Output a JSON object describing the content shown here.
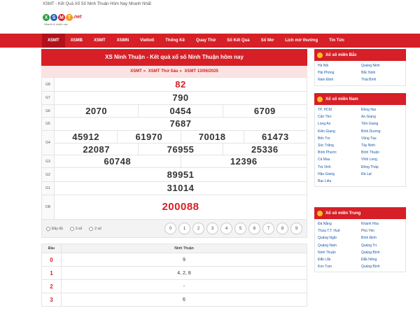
{
  "page_title": "XSMT - Kết Quả Xổ Số Ninh Thuận Hôm Nay Nhanh Nhất",
  "logo": {
    "letters": [
      "X",
      "S",
      "M",
      "T"
    ],
    "suffix": ".net",
    "slogan": "Nhanh & chính xác"
  },
  "nav": [
    "XSMT",
    "XSMB",
    "XSMT",
    "XSMN",
    "Vietlott",
    "Thống Kê",
    "Quay Thử",
    "Sổ Kết Quả",
    "Sổ Mơ",
    "Lịch mở thưởng",
    "Tin Tức"
  ],
  "main": {
    "title": "XS Ninh Thuận - Kết quả xổ số Ninh Thuận hôm nay",
    "breadcrumb": [
      "XSMT",
      "XSMT Thứ Sáu",
      "XSMT 13/06/2025"
    ],
    "prizes": [
      {
        "label": "G8",
        "rows": [
          [
            "82"
          ]
        ],
        "highlight": true
      },
      {
        "label": "G7",
        "rows": [
          [
            "790"
          ]
        ]
      },
      {
        "label": "G6",
        "rows": [
          [
            "2070",
            "0454",
            "6709"
          ]
        ]
      },
      {
        "label": "G5",
        "rows": [
          [
            "7687"
          ]
        ]
      },
      {
        "label": "G4",
        "rows": [
          [
            "45912",
            "61970",
            "70018",
            "61473"
          ],
          [
            "22087",
            "76955",
            "25336"
          ]
        ]
      },
      {
        "label": "G3",
        "rows": [
          [
            "60748",
            "12396"
          ]
        ]
      },
      {
        "label": "G2",
        "rows": [
          [
            "89951"
          ]
        ]
      },
      {
        "label": "G1",
        "rows": [
          [
            "31014"
          ]
        ]
      },
      {
        "label": "DB",
        "rows": [
          [
            "200088"
          ]
        ],
        "highlight": true
      }
    ],
    "filter": {
      "options": [
        "Đầy đủ",
        "3 số",
        "2 số"
      ],
      "digits": [
        "0",
        "1",
        "2",
        "3",
        "4",
        "5",
        "6",
        "7",
        "8",
        "9"
      ]
    },
    "loto": {
      "headers": [
        "Đầu",
        "Ninh Thuận"
      ],
      "rows": [
        [
          "0",
          "9"
        ],
        [
          "1",
          "4, 2, 8"
        ],
        [
          "2",
          "-"
        ],
        [
          "3",
          "6"
        ]
      ]
    }
  },
  "sidebar": [
    {
      "title": "Xổ số miền Bắc",
      "items": [
        "Hà Nội",
        "Quảng Ninh",
        "Hải Phòng",
        "Bắc Ninh",
        "Nam Định",
        "Thái Bình"
      ]
    },
    {
      "title": "Xổ số miền Nam",
      "items": [
        "TP. HCM",
        "Đồng Nai",
        "Cần Thơ",
        "An Giang",
        "Long An",
        "Tiền Giang",
        "Kiên Giang",
        "Bình Dương",
        "Bến Tre",
        "Vũng Tàu",
        "Sóc Trăng",
        "Tây Ninh",
        "Bình Phước",
        "Bình Thuận",
        "Cà Mau",
        "Vĩnh Long",
        "Trà Vinh",
        "Đồng Tháp",
        "Hậu Giang",
        "Đà Lạt",
        "Bạc Liêu"
      ]
    },
    {
      "title": "Xổ số miền Trung",
      "items": [
        "Đà Nẵng",
        "Khánh Hòa",
        "Thừa T.T. Huế",
        "Phú Yên",
        "Quảng Ngãi",
        "Bình Định",
        "Quảng Nam",
        "Quảng Trị",
        "Ninh Thuận",
        "Quảng Bình",
        "Đắk Lắk",
        "Đắk Nông",
        "Kon Tum",
        "Quảng Bình"
      ]
    }
  ],
  "colors": {
    "brand_red": "#d61f26",
    "ball_colors": [
      "#2a9d3b",
      "#1f5fb8",
      "#d61f26",
      "#f29a1c"
    ]
  }
}
